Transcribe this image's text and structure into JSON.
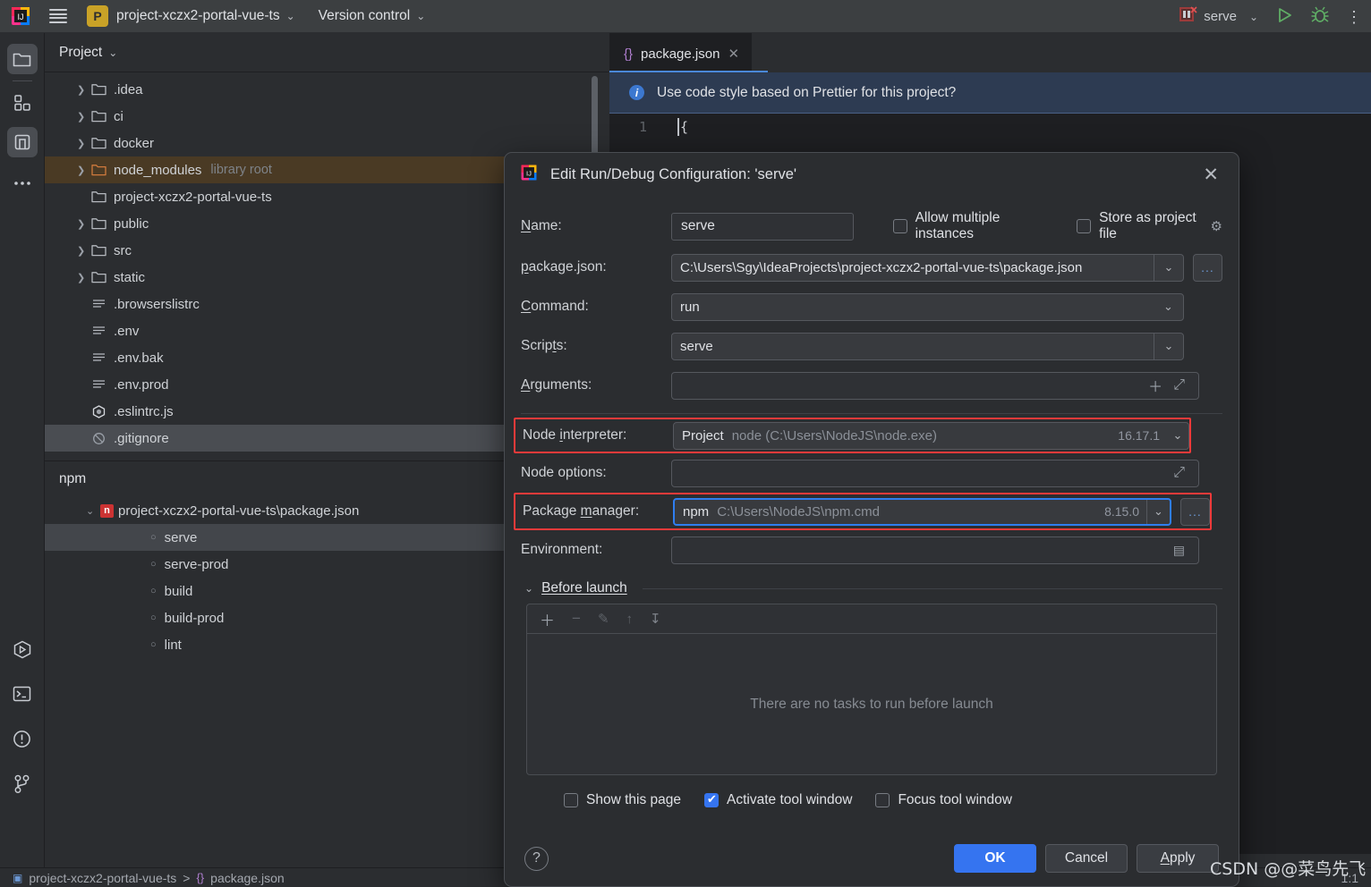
{
  "topbar": {
    "menu_icon": "hamburger-icon",
    "project_badge": "P",
    "project_name": "project-xczx2-portal-vue-ts",
    "version_control": "Version control",
    "run_config_name": "serve",
    "run_icon": "run-icon",
    "debug_icon": "debug-icon",
    "more_icon": "more-vertical-icon"
  },
  "rail": {
    "items": [
      {
        "name": "project-icon",
        "selected": true
      },
      {
        "name": "structure-icon",
        "selected": false
      },
      {
        "name": "npm-icon",
        "selected": true
      },
      {
        "name": "more-icon",
        "selected": false
      },
      {
        "name": "run-icon",
        "selected": false
      },
      {
        "name": "terminal-icon",
        "selected": false
      },
      {
        "name": "problems-icon",
        "selected": false
      },
      {
        "name": "version-control-icon",
        "selected": false
      }
    ]
  },
  "project_panel": {
    "title": "Project",
    "tree": [
      {
        "label": ".idea",
        "type": "folder",
        "arrow": true,
        "tag": "",
        "state": "normal"
      },
      {
        "label": "ci",
        "type": "folder",
        "arrow": true,
        "tag": "",
        "state": "normal"
      },
      {
        "label": "docker",
        "type": "folder",
        "arrow": true,
        "tag": "",
        "state": "normal"
      },
      {
        "label": "node_modules",
        "type": "folder-lib",
        "arrow": true,
        "tag": "library root",
        "state": "highlighted"
      },
      {
        "label": "project-xczx2-portal-vue-ts",
        "type": "folder",
        "arrow": false,
        "tag": "",
        "state": "normal"
      },
      {
        "label": "public",
        "type": "folder",
        "arrow": true,
        "tag": "",
        "state": "normal"
      },
      {
        "label": "src",
        "type": "folder",
        "arrow": true,
        "tag": "",
        "state": "normal"
      },
      {
        "label": "static",
        "type": "folder",
        "arrow": true,
        "tag": "",
        "state": "normal"
      },
      {
        "label": ".browserslistrc",
        "type": "text-file",
        "arrow": false,
        "tag": "",
        "state": "normal"
      },
      {
        "label": ".env",
        "type": "text-file",
        "arrow": false,
        "tag": "",
        "state": "normal"
      },
      {
        "label": ".env.bak",
        "type": "text-file",
        "arrow": false,
        "tag": "",
        "state": "normal"
      },
      {
        "label": ".env.prod",
        "type": "text-file",
        "arrow": false,
        "tag": "",
        "state": "normal"
      },
      {
        "label": ".eslintrc.js",
        "type": "eslint-file",
        "arrow": false,
        "tag": "",
        "state": "normal"
      },
      {
        "label": ".gitignore",
        "type": "gitignore-file",
        "arrow": false,
        "tag": "",
        "state": "selected"
      }
    ]
  },
  "npm_panel": {
    "title": "npm",
    "root": "project-xczx2-portal-vue-ts\\package.json",
    "root_badge": "n",
    "scripts": [
      {
        "label": "serve",
        "selected": true
      },
      {
        "label": "serve-prod",
        "selected": false
      },
      {
        "label": "build",
        "selected": false
      },
      {
        "label": "build-prod",
        "selected": false
      },
      {
        "label": "lint",
        "selected": false
      }
    ]
  },
  "editor": {
    "tab_label": "package.json",
    "tab_icon": "json-braces-icon",
    "tab_close_icon": "close-icon",
    "notification": "Use code style based on Prettier for this project?",
    "notification_icon": "info-icon",
    "lines": [
      {
        "number": "1",
        "text": "{"
      }
    ]
  },
  "status_bar": {
    "breadcrumb_project": "project-xczx2-portal-vue-ts",
    "breadcrumb_separator": ">",
    "breadcrumb_file": "package.json",
    "caret_position": "1:1"
  },
  "dialog": {
    "title": "Edit Run/Debug Configuration: 'serve'",
    "app_icon": "intellij-icon",
    "close_icon": "close-icon",
    "name_label": "Name:",
    "name_value": "serve",
    "allow_multiple_label": "Allow multiple instances",
    "allow_multiple_checked": false,
    "store_project_label": "Store as project file",
    "store_project_checked": false,
    "store_project_gear_icon": "gear-icon",
    "fields": {
      "package_json_label": "package.json:",
      "package_json_value": "C:\\Users\\Sgy\\IdeaProjects\\project-xczx2-portal-vue-ts\\package.json",
      "command_label": "Command:",
      "command_value": "run",
      "scripts_label": "Scripts:",
      "scripts_value": "serve",
      "arguments_label": "Arguments:",
      "arguments_value": "",
      "node_interpreter_label": "Node interpreter:",
      "node_interpreter_scope": "Project",
      "node_interpreter_value": "node (C:\\Users\\NodeJS\\node.exe)",
      "node_interpreter_version": "16.17.1",
      "node_options_label": "Node options:",
      "node_options_value": "",
      "package_manager_label": "Package manager:",
      "package_manager_name": "npm",
      "package_manager_value": "C:\\Users\\NodeJS\\npm.cmd",
      "package_manager_version": "8.15.0",
      "environment_label": "Environment:",
      "environment_value": "",
      "browse_label": "...",
      "add_icon": "plus-icon",
      "expand_icon": "expand-icon",
      "env_list_icon": "list-icon"
    },
    "before_launch": {
      "title": "Before launch",
      "toolbar": [
        "plus-icon",
        "minus-icon",
        "edit-icon",
        "move-up-icon",
        "move-down-icon"
      ],
      "empty_text": "There are no tasks to run before launch"
    },
    "checkboxes": [
      {
        "label": "Show this page",
        "checked": false
      },
      {
        "label": "Activate tool window",
        "checked": true
      },
      {
        "label": "Focus tool window",
        "checked": false
      }
    ],
    "help_icon": "help-icon",
    "buttons": {
      "ok": "OK",
      "cancel": "Cancel",
      "apply": "Apply"
    },
    "highlight_colors": {
      "red": "#f03a3a",
      "blue": "#2f7ef0"
    }
  },
  "watermark": "CSDN @@菜鸟先飞"
}
